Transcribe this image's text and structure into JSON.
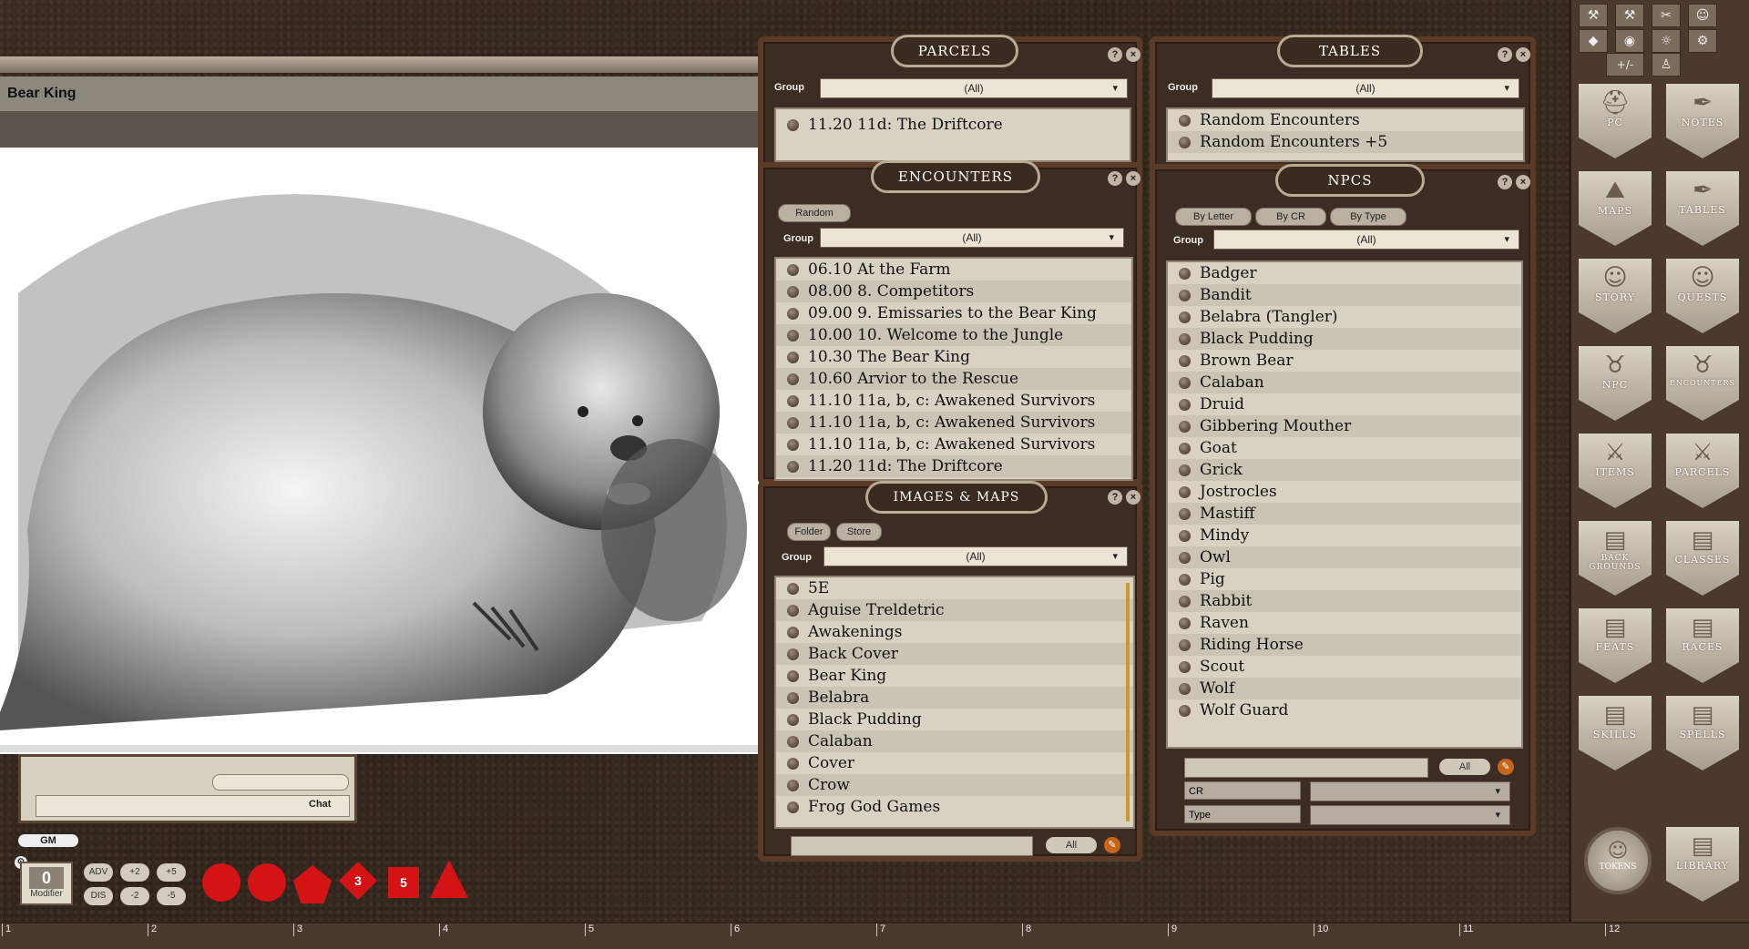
{
  "image_window": {
    "title": "Bear King"
  },
  "chat": {
    "chat_button": "Chat",
    "gm_label": "GM"
  },
  "modifier": {
    "value": "0",
    "label": "Modifier",
    "buttons": [
      "ADV",
      "+2",
      "+5",
      "DIS",
      "-2",
      "-5"
    ]
  },
  "dice": [
    "d20",
    "d12",
    "d10",
    "d8",
    "d6",
    "d4"
  ],
  "dice_faces": [
    "",
    "",
    "",
    "3",
    "5",
    ""
  ],
  "ruler": [
    "1",
    "2",
    "3",
    "4",
    "5",
    "6",
    "7",
    "8",
    "9",
    "10",
    "11",
    "12"
  ],
  "parcels": {
    "title": "PARCELS",
    "group_label": "Group",
    "group_value": "(All)",
    "items": [
      "11.20 11d: The Driftcore"
    ]
  },
  "tables": {
    "title": "TABLES",
    "group_label": "Group",
    "group_value": "(All)",
    "items": [
      "Random Encounters",
      "Random Encounters +5"
    ]
  },
  "encounters": {
    "title": "ENCOUNTERS",
    "random_button": "Random",
    "group_label": "Group",
    "group_value": "(All)",
    "items": [
      "06.10 At the Farm",
      "08.00 8. Competitors",
      "09.00 9. Emissaries to the Bear King",
      "10.00 10. Welcome to the Jungle",
      "10.30 The Bear King",
      "10.60 Arvior to the Rescue",
      "11.10 11a, b, c: Awakened Survivors",
      "11.10 11a, b, c: Awakened Survivors",
      "11.10 11a, b, c: Awakened Survivors",
      "11.20 11d: The Driftcore"
    ]
  },
  "images": {
    "title": "IMAGES & MAPS",
    "folder_button": "Folder",
    "store_button": "Store",
    "group_label": "Group",
    "group_value": "(All)",
    "items": [
      "5E",
      "Aguise Treldetric",
      "Awakenings",
      "Back Cover",
      "Bear King",
      "Belabra",
      "Black Pudding",
      "Calaban",
      "Cover",
      "Crow",
      "Frog God Games"
    ],
    "all_button": "All"
  },
  "npcs": {
    "title": "NPCS",
    "tabs": [
      "By Letter",
      "By CR",
      "By Type"
    ],
    "group_label": "Group",
    "group_value": "(All)",
    "items": [
      "Badger",
      "Bandit",
      "Belabra (Tangler)",
      "Black Pudding",
      "Brown Bear",
      "Calaban",
      "Druid",
      "Gibbering Mouther",
      "Goat",
      "Grick",
      "Jostrocles",
      "Mastiff",
      "Mindy",
      "Owl",
      "Pig",
      "Rabbit",
      "Raven",
      "Riding Horse",
      "Scout",
      "Wolf",
      "Wolf Guard"
    ],
    "all_button": "All",
    "filters": [
      "CR",
      "Type"
    ]
  },
  "sidebar": {
    "toolbar_row2_label": "+/-",
    "shields": [
      {
        "label": "PC",
        "icon": "helmet-icon"
      },
      {
        "label": "NOTES",
        "icon": "quill-icon"
      },
      {
        "label": "MAPS",
        "icon": "map-icon"
      },
      {
        "label": "TABLES",
        "icon": "table-quill-icon"
      },
      {
        "label": "STORY",
        "icon": "masks-icon"
      },
      {
        "label": "QUESTS",
        "icon": "masks-icon"
      },
      {
        "label": "NPC",
        "icon": "demon-icon"
      },
      {
        "label": "ENCOUNTERS",
        "icon": "demon-icon"
      },
      {
        "label": "ITEMS",
        "icon": "sword-shield-icon"
      },
      {
        "label": "PARCELS",
        "icon": "sword-shield-icon"
      },
      {
        "label": "BACK GROUNDS",
        "icon": "book-icon"
      },
      {
        "label": "CLASSES",
        "icon": "book-icon"
      },
      {
        "label": "FEATS",
        "icon": "book-icon"
      },
      {
        "label": "RACES",
        "icon": "book-icon"
      },
      {
        "label": "SKILLS",
        "icon": "book-icon"
      },
      {
        "label": "SPELLS",
        "icon": "book-icon"
      }
    ],
    "tokens_label": "TOKENS",
    "library_label": "LIBRARY"
  }
}
